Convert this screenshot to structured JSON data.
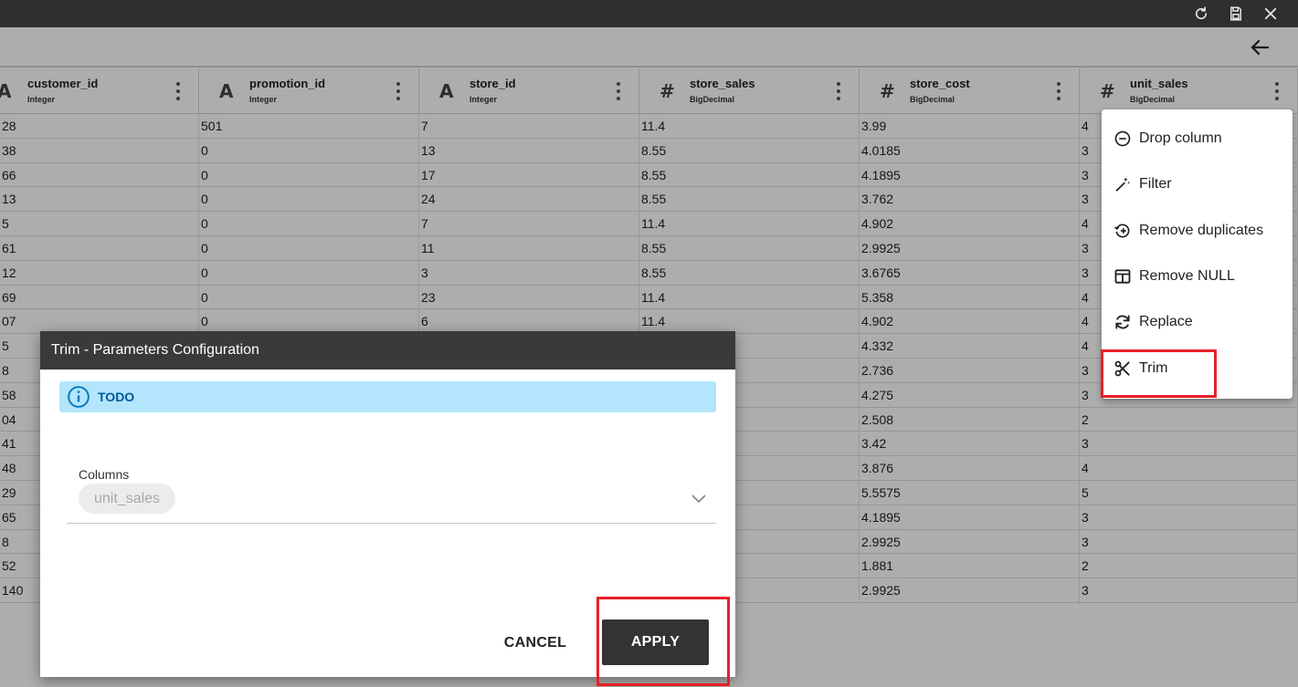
{
  "table": {
    "columns": [
      {
        "name": "customer_id",
        "type": "Integer",
        "icon": "A"
      },
      {
        "name": "promotion_id",
        "type": "Integer",
        "icon": "A"
      },
      {
        "name": "store_id",
        "type": "Integer",
        "icon": "A"
      },
      {
        "name": "store_sales",
        "type": "BigDecimal",
        "icon": "#"
      },
      {
        "name": "store_cost",
        "type": "BigDecimal",
        "icon": "#"
      },
      {
        "name": "unit_sales",
        "type": "BigDecimal",
        "icon": "#"
      }
    ],
    "rows": [
      [
        "28",
        "501",
        "7",
        "11.4",
        "3.99",
        "4"
      ],
      [
        "38",
        "0",
        "13",
        "8.55",
        "4.0185",
        "3"
      ],
      [
        "66",
        "0",
        "17",
        "8.55",
        "4.1895",
        "3"
      ],
      [
        "13",
        "0",
        "24",
        "8.55",
        "3.762",
        "3"
      ],
      [
        "5",
        "0",
        "7",
        "11.4",
        "4.902",
        "4"
      ],
      [
        "61",
        "0",
        "11",
        "8.55",
        "2.9925",
        "3"
      ],
      [
        "12",
        "0",
        "3",
        "8.55",
        "3.6765",
        "3"
      ],
      [
        "69",
        "0",
        "23",
        "11.4",
        "5.358",
        "4"
      ],
      [
        "07",
        "0",
        "6",
        "11.4",
        "4.902",
        "4"
      ],
      [
        "5",
        "",
        "",
        "",
        "4.332",
        "4"
      ],
      [
        "8",
        "",
        "",
        "",
        "2.736",
        "3"
      ],
      [
        "58",
        "",
        "",
        "",
        "4.275",
        "3"
      ],
      [
        "04",
        "",
        "",
        "",
        "2.508",
        "2"
      ],
      [
        "41",
        "",
        "",
        "",
        "3.42",
        "3"
      ],
      [
        "48",
        "",
        "",
        "",
        "3.876",
        "4"
      ],
      [
        "29",
        "",
        "",
        "",
        "5.5575",
        "5"
      ],
      [
        "65",
        "",
        "",
        "",
        "4.1895",
        "3"
      ],
      [
        "8",
        "",
        "",
        "",
        "2.9925",
        "3"
      ],
      [
        "52",
        "",
        "",
        "",
        "1.881",
        "2"
      ],
      [
        "140",
        "",
        "",
        "",
        "2.9925",
        "3"
      ]
    ]
  },
  "menu": {
    "items": [
      {
        "label": "Drop column",
        "icon": "minus-circle-icon"
      },
      {
        "label": "Filter",
        "icon": "magic-wand-icon"
      },
      {
        "label": "Remove duplicates",
        "icon": "plus-circle-arrow-icon"
      },
      {
        "label": "Remove NULL",
        "icon": "table-columns-icon"
      },
      {
        "label": "Replace",
        "icon": "refresh-icon"
      },
      {
        "label": "Trim",
        "icon": "scissors-icon"
      }
    ]
  },
  "dialog": {
    "title": "Trim - Parameters Configuration",
    "info_text": "TODO",
    "columns_label": "Columns",
    "selected_column": "unit_sales",
    "cancel_label": "CANCEL",
    "apply_label": "APPLY"
  },
  "colors": {
    "titlebar": "#2f2f2f",
    "dialog_header": "#3a3a3a",
    "info_bg": "#b3e5fc",
    "info_text": "#01579b",
    "apply_bg": "#333333",
    "highlight": "#e8202a"
  }
}
